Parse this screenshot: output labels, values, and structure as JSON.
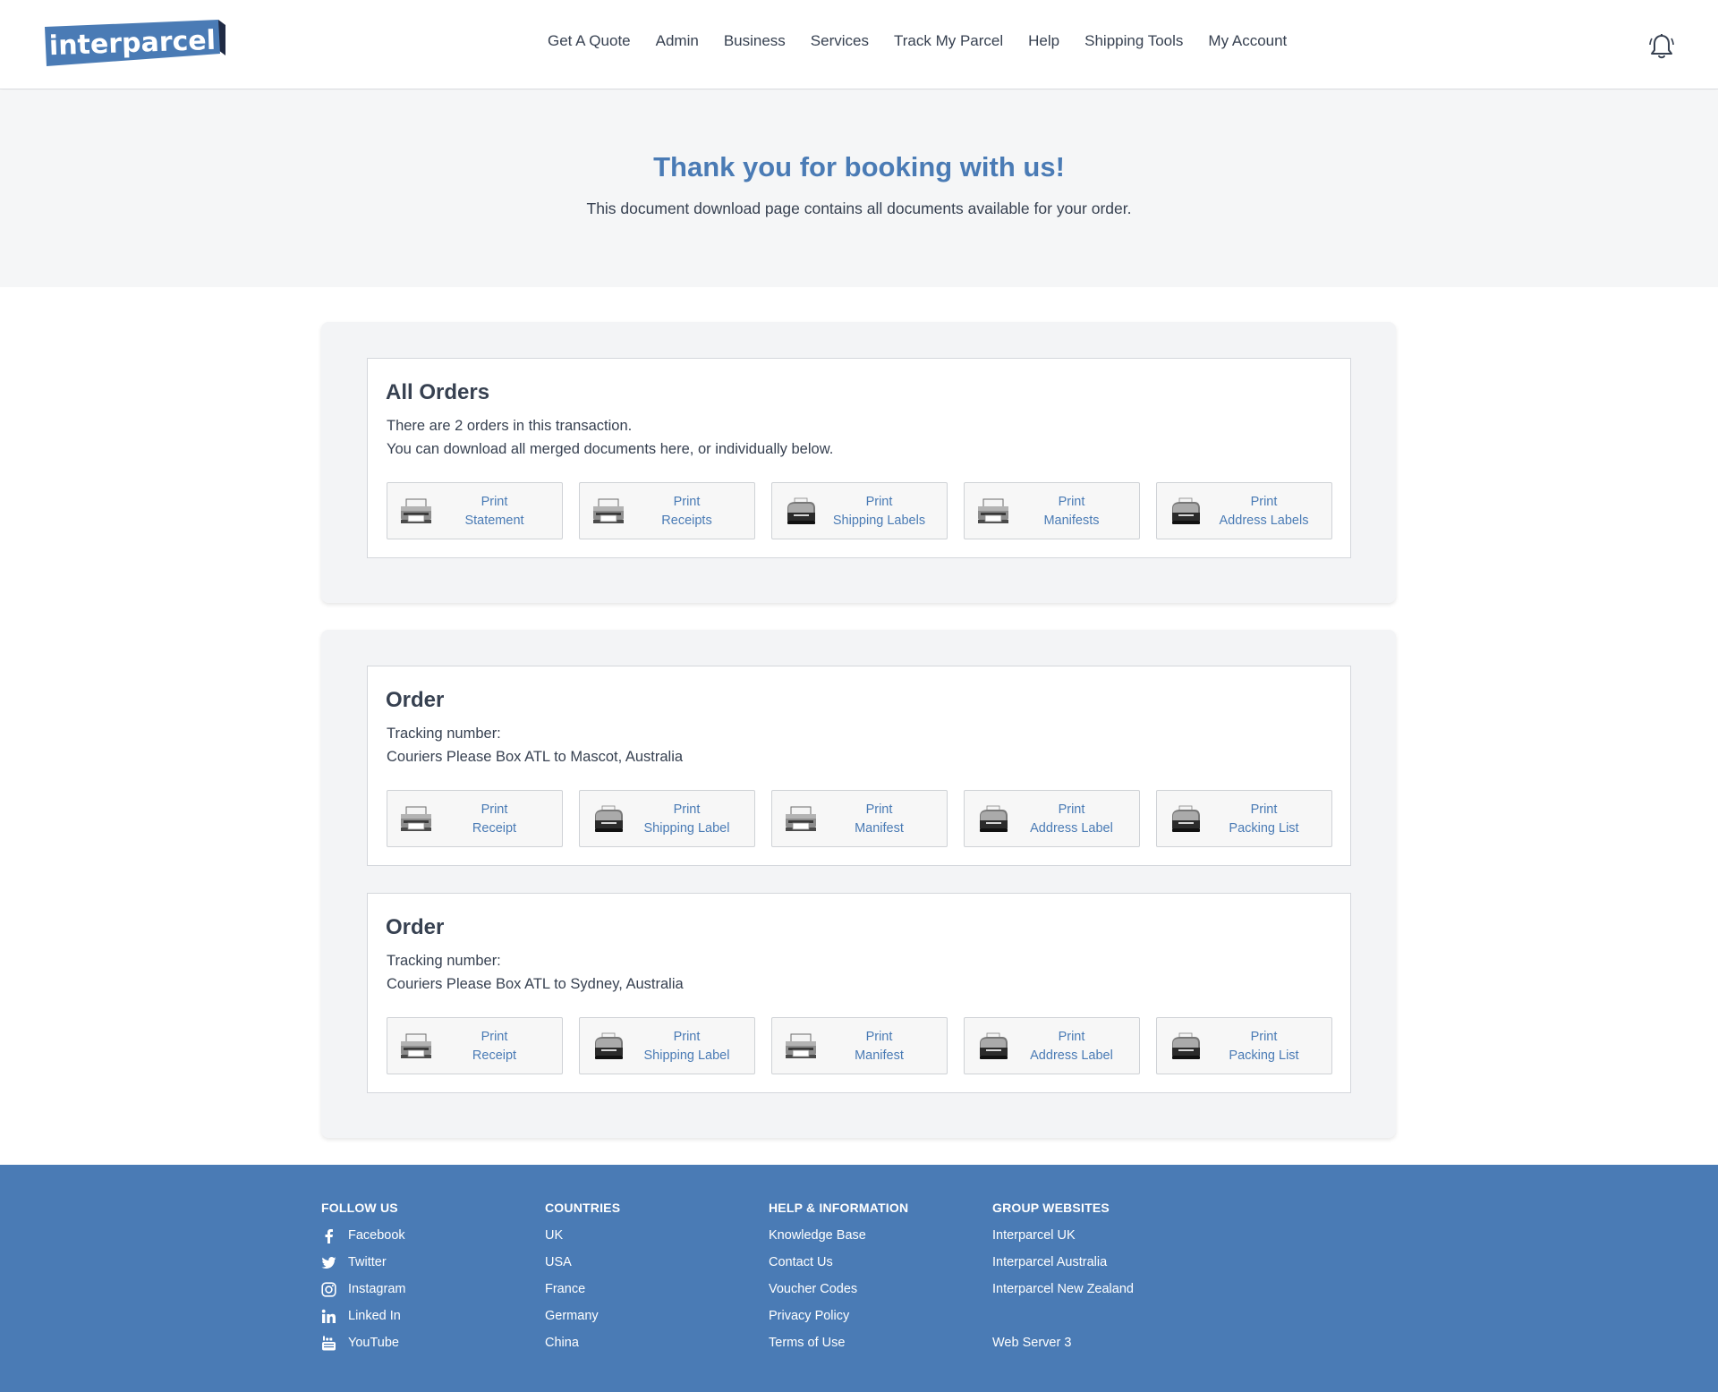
{
  "brand": {
    "logo_text": "interparcel",
    "primary_color": "#4a7bb5"
  },
  "nav": {
    "items": [
      "Get A Quote",
      "Admin",
      "Business",
      "Services",
      "Track My Parcel",
      "Help",
      "Shipping Tools",
      "My Account"
    ]
  },
  "hero": {
    "title": "Thank you for booking with us!",
    "subtitle": "This document download page contains all documents available for your order."
  },
  "all_orders": {
    "title": "All Orders",
    "line1": "There are 2 orders in this transaction.",
    "line2": "You can download all merged documents here, or individually below.",
    "buttons": [
      {
        "line1": "Print",
        "line2": "Statement",
        "icon": "printer-icon"
      },
      {
        "line1": "Print",
        "line2": "Receipts",
        "icon": "printer-icon"
      },
      {
        "line1": "Print",
        "line2": "Shipping Labels",
        "icon": "label-printer-icon"
      },
      {
        "line1": "Print",
        "line2": "Manifests",
        "icon": "printer-icon"
      },
      {
        "line1": "Print",
        "line2": "Address Labels",
        "icon": "label-printer-icon"
      }
    ]
  },
  "orders": [
    {
      "title": "Order",
      "tracking_label": "Tracking number:",
      "route": "Couriers Please Box ATL to Mascot, Australia",
      "buttons": [
        {
          "line1": "Print",
          "line2": "Receipt",
          "icon": "printer-icon"
        },
        {
          "line1": "Print",
          "line2": "Shipping Label",
          "icon": "label-printer-icon"
        },
        {
          "line1": "Print",
          "line2": "Manifest",
          "icon": "printer-icon"
        },
        {
          "line1": "Print",
          "line2": "Address Label",
          "icon": "label-printer-icon"
        },
        {
          "line1": "Print",
          "line2": "Packing List",
          "icon": "label-printer-icon"
        }
      ]
    },
    {
      "title": "Order",
      "tracking_label": "Tracking number:",
      "route": "Couriers Please Box ATL to Sydney, Australia",
      "buttons": [
        {
          "line1": "Print",
          "line2": "Receipt",
          "icon": "printer-icon"
        },
        {
          "line1": "Print",
          "line2": "Shipping Label",
          "icon": "label-printer-icon"
        },
        {
          "line1": "Print",
          "line2": "Manifest",
          "icon": "printer-icon"
        },
        {
          "line1": "Print",
          "line2": "Address Label",
          "icon": "label-printer-icon"
        },
        {
          "line1": "Print",
          "line2": "Packing List",
          "icon": "label-printer-icon"
        }
      ]
    }
  ],
  "footer": {
    "follow": {
      "title": "FOLLOW US",
      "items": [
        {
          "label": "Facebook",
          "icon": "facebook-icon"
        },
        {
          "label": "Twitter",
          "icon": "twitter-icon"
        },
        {
          "label": "Instagram",
          "icon": "instagram-icon"
        },
        {
          "label": "Linked In",
          "icon": "linkedin-icon"
        },
        {
          "label": "YouTube",
          "icon": "youtube-icon"
        }
      ]
    },
    "countries": {
      "title": "COUNTRIES",
      "items": [
        "UK",
        "USA",
        "France",
        "Germany",
        "China"
      ]
    },
    "help": {
      "title": "HELP & INFORMATION",
      "items": [
        "Knowledge Base",
        "Contact Us",
        "Voucher Codes",
        "Privacy Policy",
        "Terms of Use"
      ]
    },
    "group": {
      "title": "GROUP WEBSITES",
      "items": [
        "Interparcel UK",
        "Interparcel Australia",
        "Interparcel New Zealand"
      ],
      "server": "Web Server 3"
    }
  }
}
